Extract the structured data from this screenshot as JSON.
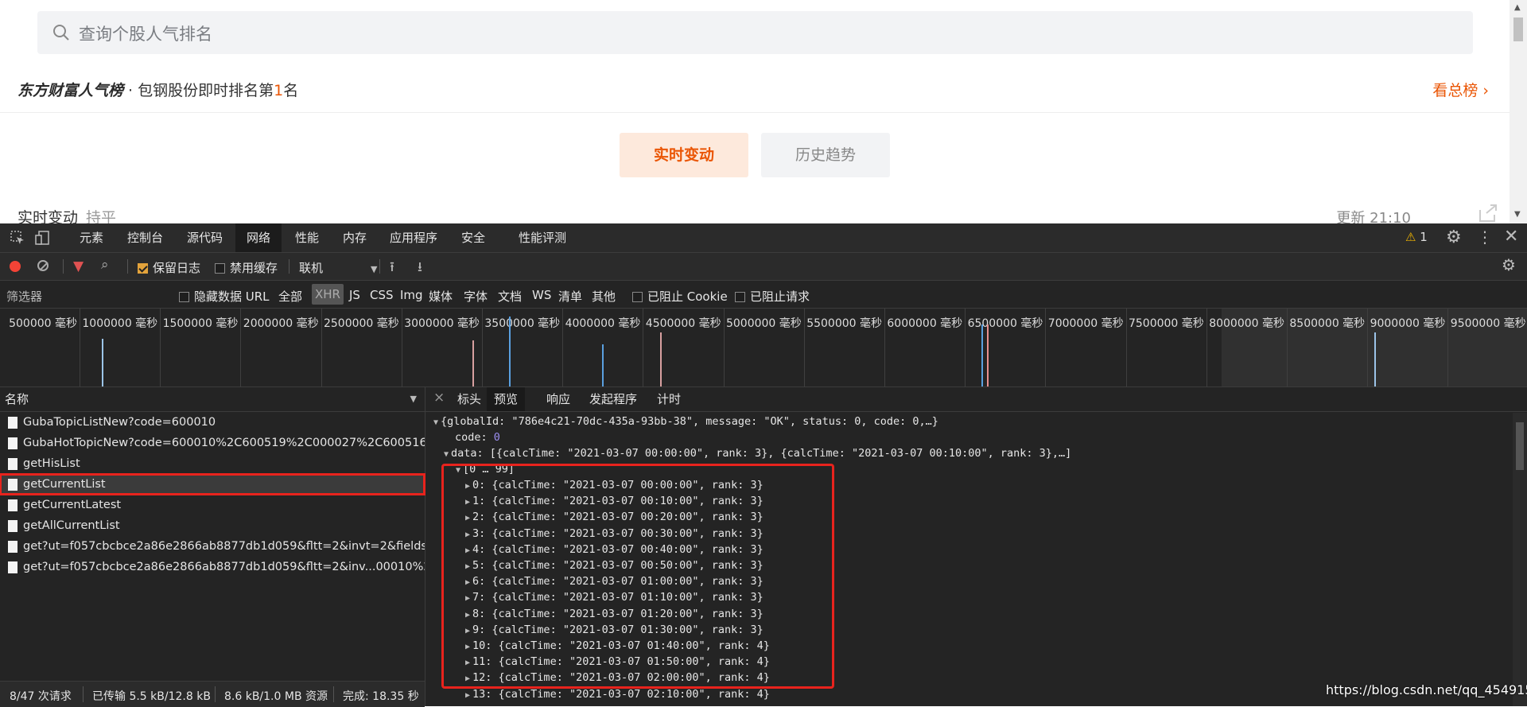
{
  "web": {
    "search_placeholder": "查询个股人气排名",
    "brand": "东方财富人气榜",
    "rank_prefix": " · 包钢股份即时排名第",
    "rank_number": "1",
    "rank_suffix": "名",
    "view_all": "看总榜",
    "tab_realtime": "实时变动",
    "tab_history": "历史趋势",
    "realtime_label": "实时变动",
    "flat_label": "持平",
    "updated": "更新 21:10"
  },
  "devtools": {
    "tabs": [
      "元素",
      "控制台",
      "源代码",
      "网络",
      "性能",
      "内存",
      "应用程序",
      "安全",
      "性能评测"
    ],
    "warning_count": "1",
    "preserve_log": "保留日志",
    "disable_cache": "禁用缓存",
    "throttle": "联机",
    "filter_placeholder": "筛选器",
    "hide_data_url": "隐藏数据 URL",
    "types": [
      "全部",
      "XHR",
      "JS",
      "CSS",
      "Img",
      "媒体",
      "字体",
      "文档",
      "WS",
      "清单",
      "其他"
    ],
    "blocked_cookie": "已阻止 Cookie",
    "blocked_requests": "已阻止请求",
    "timeline_ticks": [
      "500000 毫秒",
      "1000000 毫秒",
      "1500000 毫秒",
      "2000000 毫秒",
      "2500000 毫秒",
      "3000000 毫秒",
      "3500000 毫秒",
      "4000000 毫秒",
      "4500000 毫秒",
      "5000000 毫秒",
      "5500000 毫秒",
      "6000000 毫秒",
      "6500000 毫秒",
      "7000000 毫秒",
      "7500000 毫秒",
      "8000000 毫秒",
      "8500000 毫秒",
      "9000000 毫秒",
      "9500000 毫秒"
    ],
    "names_header": "名称",
    "requests": [
      "GubaTopicListNew?code=600010",
      "GubaHotTopicNew?code=600010%2C600519%2C000027%2C600516%2...",
      "getHisList",
      "getCurrentList",
      "getCurrentLatest",
      "getAllCurrentList",
      "get?ut=f057cbcbce2a86e2866ab8877db1d059&fltt=2&invt=2&fields=f1...",
      "get?ut=f057cbcbce2a86e2866ab8877db1d059&fltt=2&inv...00010%2C1..."
    ],
    "footer": {
      "requests": "8/47 次请求",
      "transferred": "已传输 5.5 kB/12.8 kB",
      "resources": "8.6 kB/1.0 MB 资源",
      "finish": "完成: 18.35 秒"
    },
    "preview_tabs": [
      "标头",
      "预览",
      "响应",
      "发起程序",
      "计时"
    ],
    "json": {
      "root": "{globalId: \"786e4c21-70dc-435a-93bb-38\", message: \"OK\", status: 0, code: 0,…}",
      "code_key": "code: ",
      "code_val": "0",
      "data": "data: [{calcTime: \"2021-03-07 00:00:00\", rank: 3}, {calcTime: \"2021-03-07 00:10:00\", rank: 3},…]",
      "range": "[0 … 99]",
      "items": [
        "0: {calcTime: \"2021-03-07 00:00:00\", rank: 3}",
        "1: {calcTime: \"2021-03-07 00:10:00\", rank: 3}",
        "2: {calcTime: \"2021-03-07 00:20:00\", rank: 3}",
        "3: {calcTime: \"2021-03-07 00:30:00\", rank: 3}",
        "4: {calcTime: \"2021-03-07 00:40:00\", rank: 3}",
        "5: {calcTime: \"2021-03-07 00:50:00\", rank: 3}",
        "6: {calcTime: \"2021-03-07 01:00:00\", rank: 3}",
        "7: {calcTime: \"2021-03-07 01:10:00\", rank: 3}",
        "8: {calcTime: \"2021-03-07 01:20:00\", rank: 3}",
        "9: {calcTime: \"2021-03-07 01:30:00\", rank: 3}",
        "10: {calcTime: \"2021-03-07 01:40:00\", rank: 4}",
        "11: {calcTime: \"2021-03-07 01:50:00\", rank: 4}",
        "12: {calcTime: \"2021-03-07 02:00:00\", rank: 4}",
        "13: {calcTime: \"2021-03-07 02:10:00\", rank: 4}"
      ]
    }
  },
  "watermark": "https://blog.csdn.net/qq_45491537",
  "colors": {
    "accent": "#ea5504",
    "highlight_box": "#e8231d",
    "devtools_bg": "#242424"
  }
}
